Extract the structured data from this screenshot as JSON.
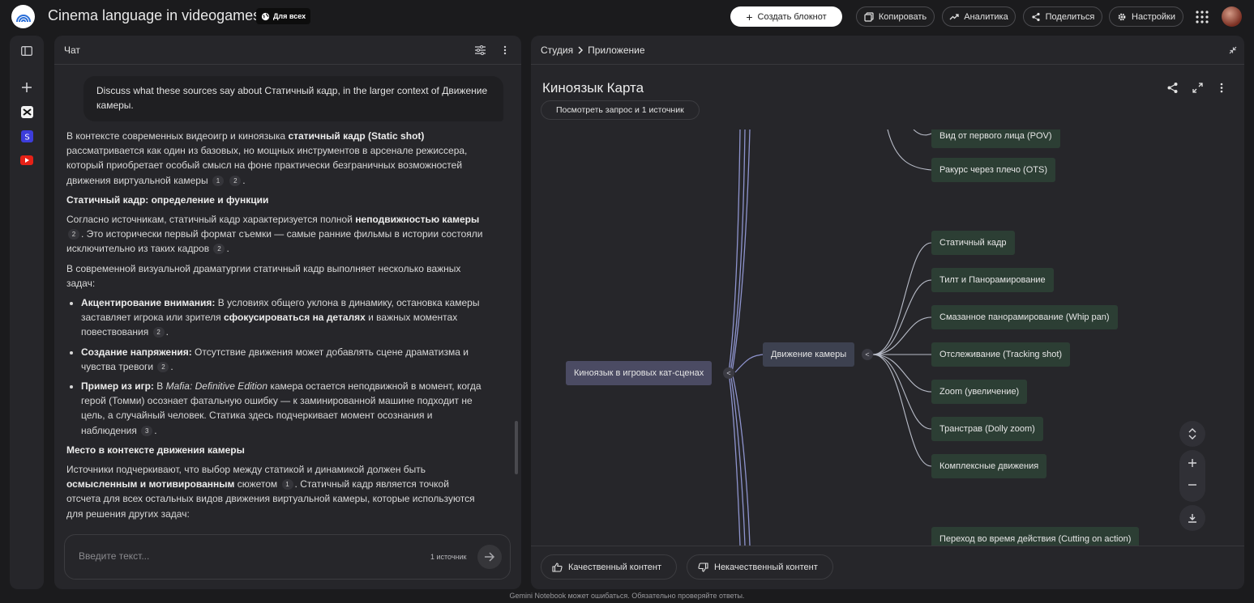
{
  "app": {
    "notebook_title": "Cinema language in videogames",
    "visibility_badge": "Для всех"
  },
  "toolbar": {
    "create_label": "Создать блокнот",
    "copy_label": "Копировать",
    "analytics_label": "Аналитика",
    "share_label": "Поделиться",
    "settings_label": "Настройки"
  },
  "chat": {
    "title": "Чат",
    "user_message": "Discuss what these sources say about Статичный кадр, in the larger context of Движение камеры.",
    "p1_a": "В контексте современных видеоигр и киноязыка ",
    "p1_b": "статичный кадр (Static shot)",
    "p1_c": " рассматривается как один из базовых, но мощных инструментов в арсенале режиссера, который приобретает особый смысл на фоне практически безграничных возможностей движения виртуальной камеры",
    "cite_1": "1",
    "cite_2": "2",
    "cite_3": "3",
    "h1": "Статичный кадр: определение и функции",
    "p2_a": "Согласно источникам, статичный кадр характеризуется полной ",
    "p2_b": "неподвижностью камеры",
    "p2_c": ". Это исторически первый формат съемки — самые ранние фильмы в истории состояли исключительно из таких кадров",
    "p3": "В современной визуальной драматургии статичный кадр выполняет несколько важных задач:",
    "li1_a": "Акцентирование внимания:",
    "li1_b": " В условиях общего уклона в динамику, остановка камеры заставляет игрока или зрителя ",
    "li1_c": "сфокусироваться на деталях",
    "li1_d": " и важных моментах повествования",
    "li2_a": "Создание напряжения:",
    "li2_b": " Отсутствие движения может добавлять сцене драматизма и чувства тревоги",
    "li3_a": "Пример из игр:",
    "li3_b": " В ",
    "li3_c": "Mafia: Definitive Edition",
    "li3_d": " камера остается неподвижной в момент, когда герой (Томми) осознает фатальную ошибку — к заминированной машине подходит не цель, а случайный человек. Статика здесь подчеркивает момент осознания и наблюдения",
    "h2": "Место в контексте движения камеры",
    "p4_a": "Источники подчеркивают, что выбор между статикой и динамикой должен быть ",
    "p4_b": "осмысленным и мотивированным",
    "p4_c": " сюжетом",
    "p4_d": ". Статичный кадр является точкой отсчета для всех остальных видов движения виртуальной камеры, которые используются для решения других задач:",
    "input_placeholder": "Введите текст...",
    "source_count": "1 источник"
  },
  "studio": {
    "crumb_studio": "Студия",
    "crumb_app": "Приложение",
    "map_title": "Киноязык Карта",
    "view_query_label": "Посмотреть запрос и 1 источник",
    "root_node": "Киноязык в игровых кат-сценах",
    "mid_node": "Движение камеры",
    "toggle_symbol": "<",
    "top_nodes": [
      "Вид от первого лица (POV)",
      "Ракурс через плечо (OTS)"
    ],
    "camera_nodes": [
      "Статичный кадр",
      "Тилт и Панорамирование",
      "Смазанное панорамирование (Whip pan)",
      "Отслеживание (Tracking shot)",
      "Zoom (увеличение)",
      "Транстрав (Dolly zoom)",
      "Комплексные движения"
    ],
    "bottom_node": "Переход во время действия (Cutting on action)",
    "good_label": "Качественный контент",
    "bad_label": "Некачественный контент"
  },
  "footer": {
    "disclaimer": "Gemini Notebook может ошибаться. Обязательно проверяйте ответы."
  }
}
